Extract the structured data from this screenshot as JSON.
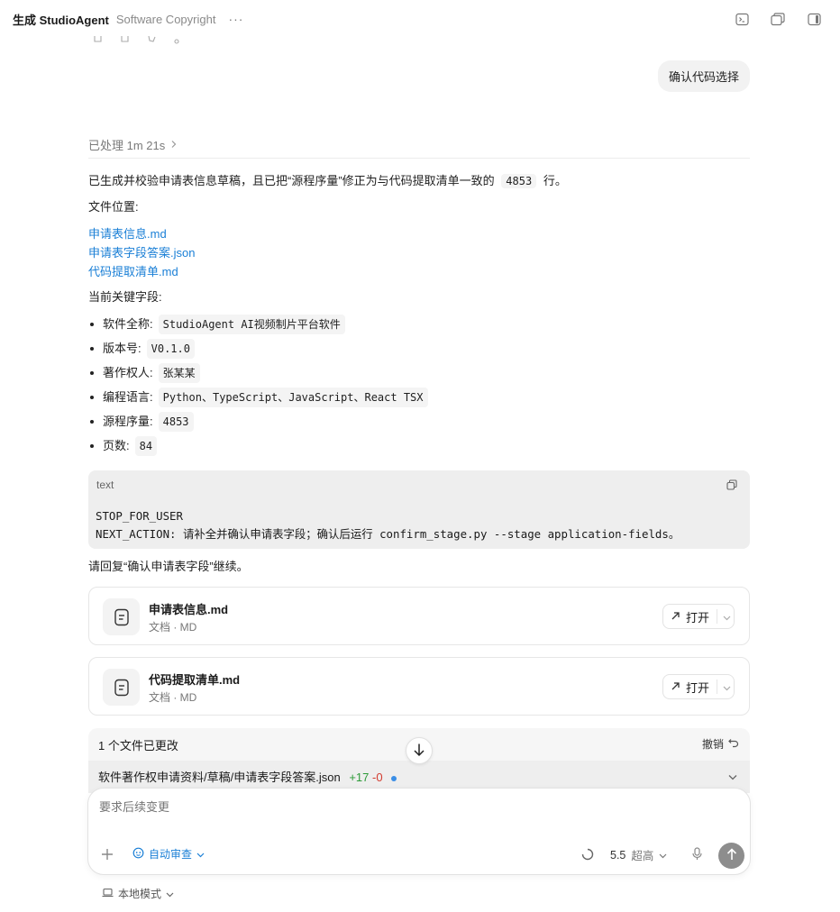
{
  "header": {
    "title": "生成 StudioAgent",
    "subtitle": "Software Copyright",
    "more": "···",
    "icons": [
      "terminal-icon",
      "window-copy-icon",
      "sidebar-toggle-icon"
    ]
  },
  "user_message": "确认代码选择",
  "processed_label": "已处理 1m 21s",
  "assistant": {
    "intro_prefix": "已生成并校验申请表信息草稿，且已把“源程序量”修正为与代码提取清单一致的",
    "intro_code": "4853",
    "intro_suffix": "行。",
    "files_label": "文件位置:",
    "file_links": [
      "申请表信息.md",
      "申请表字段答案.json",
      "代码提取清单.md"
    ],
    "fields_label": "当前关键字段:",
    "fields": [
      {
        "label": "软件全称:",
        "value": "StudioAgent AI视频制片平台软件"
      },
      {
        "label": "版本号:",
        "value": "V0.1.0"
      },
      {
        "label": "著作权人:",
        "value": "张某某"
      },
      {
        "label": "编程语言:",
        "value": "Python、TypeScript、JavaScript、React TSX"
      },
      {
        "label": "源程序量:",
        "value": "4853"
      },
      {
        "label": "页数:",
        "value": "84"
      }
    ],
    "code_block": {
      "lang": "text",
      "line1": "STOP_FOR_USER",
      "line2": "NEXT_ACTION: 请补全并确认申请表字段；确认后运行 confirm_stage.py --stage application-fields。"
    },
    "reply_hint": "请回复“确认申请表字段”继续。"
  },
  "file_cards": [
    {
      "name": "申请表信息.md",
      "meta": "文档 · MD",
      "open": "打开"
    },
    {
      "name": "代码提取清单.md",
      "meta": "文档 · MD",
      "open": "打开"
    }
  ],
  "changes": {
    "title": "1 个文件已更改",
    "undo": "撤销",
    "path": "软件著作权申请资料/草稿/申请表字段答案.json",
    "added": "+17",
    "removed": "-0"
  },
  "composer": {
    "placeholder": "要求后续变更",
    "review": "自动审查",
    "model": "5.5",
    "level": "超高"
  },
  "footer": {
    "mode": "本地模式"
  },
  "colors": {
    "link": "#1a7fd6",
    "added": "#2e9b3a",
    "removed": "#d33b2f",
    "send_button": "#8d8d8d"
  }
}
